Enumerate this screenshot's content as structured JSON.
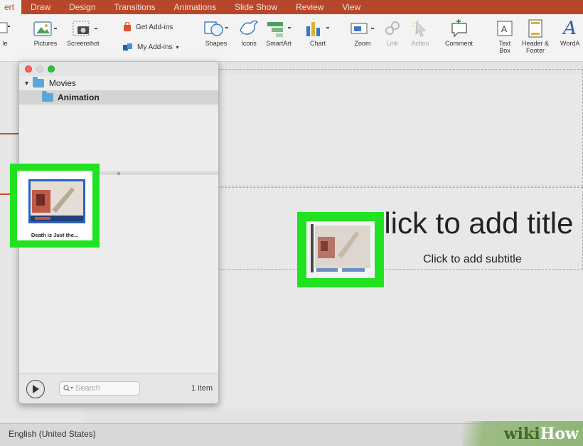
{
  "ribbon": {
    "tabs": [
      {
        "label": "ert",
        "active": true
      },
      {
        "label": "Draw"
      },
      {
        "label": "Design"
      },
      {
        "label": "Transitions"
      },
      {
        "label": "Animations"
      },
      {
        "label": "Slide Show"
      },
      {
        "label": "Review"
      },
      {
        "label": "View"
      }
    ],
    "buttons": {
      "slide_partial": "le",
      "pictures": "Pictures",
      "screenshot": "Screenshot",
      "get_addins": "Get Add-ins",
      "my_addins": "My Add-ins",
      "shapes": "Shapes",
      "icons": "Icons",
      "smartart": "SmartArt",
      "chart": "Chart",
      "zoom": "Zoom",
      "link": "Link",
      "action": "Action",
      "comment": "Comment",
      "textbox_line1": "Text",
      "textbox_line2": "Box",
      "header_line1": "Header &",
      "header_line2": "Footer",
      "wordart": "WordA"
    }
  },
  "finder": {
    "tree": {
      "root": "Movies",
      "child": "Animation"
    },
    "search_placeholder": "Search",
    "item_count": "1 item",
    "file_caption": "Death is Just the..."
  },
  "slide": {
    "title_placeholder": "Click to add title",
    "subtitle_placeholder": "Click to add subtitle"
  },
  "status": {
    "language": "English (United States)"
  },
  "watermark": {
    "part1": "wiki",
    "part2": "How"
  },
  "colors": {
    "ribbon_tab_bg": "#b7472a",
    "highlight": "#21e221",
    "folder": "#5da7d7"
  }
}
